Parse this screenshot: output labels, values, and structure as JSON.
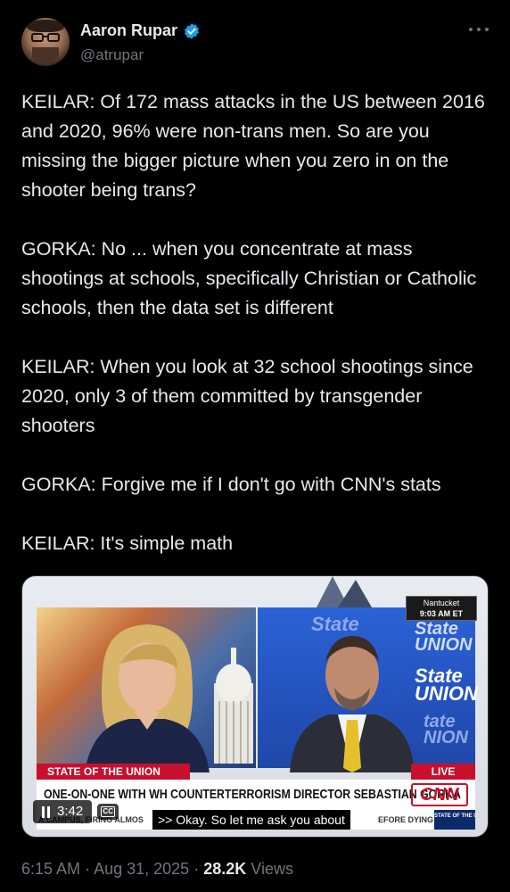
{
  "author": {
    "display_name": "Aaron Rupar",
    "handle": "@atrupar",
    "verified_color": "#1d9bf0"
  },
  "tweet": {
    "paragraphs": [
      "KEILAR: Of 172 mass attacks in the US between 2016 and 2020, 96% were non-trans men. So are you missing the bigger picture when you zero in on the shooter being trans?",
      "GORKA: No ... when you concentrate at mass shootings at schools, specifically Christian or Catholic schools, then the data set is different",
      "KEILAR: When you look at 32 school shootings since 2020, only 3 of them committed by transgender shooters",
      "GORKA: Forgive me if I don't go with CNN's stats",
      "KEILAR: It's simple math"
    ]
  },
  "video": {
    "location": "Nantucket",
    "clock": "9:03 AM ET",
    "show_bar": "STATE OF THE UNION",
    "live_label": "LIVE",
    "headline": "ONE-ON-ONE WITH WH COUNTERTERRORISM DIRECTOR SEBASTIAN GORKA",
    "network_logo": "CNN",
    "ticker_left": "A CAMPUS, FIRING ALMOS",
    "caption": ">> Okay. So let me ask you about",
    "ticker_right": "EFORE DYING",
    "show_badge": "STATE OF THE UNION",
    "state_tiles": [
      "State",
      "UNION",
      "State",
      "UNION",
      "tate",
      "NION"
    ],
    "duration": "3:42",
    "cc_label": "CC",
    "brand_color": "#c8102e"
  },
  "meta": {
    "time": "6:15 AM",
    "separator": "·",
    "date": "Aug 31, 2025",
    "views_count": "28.2K",
    "views_label": "Views"
  }
}
